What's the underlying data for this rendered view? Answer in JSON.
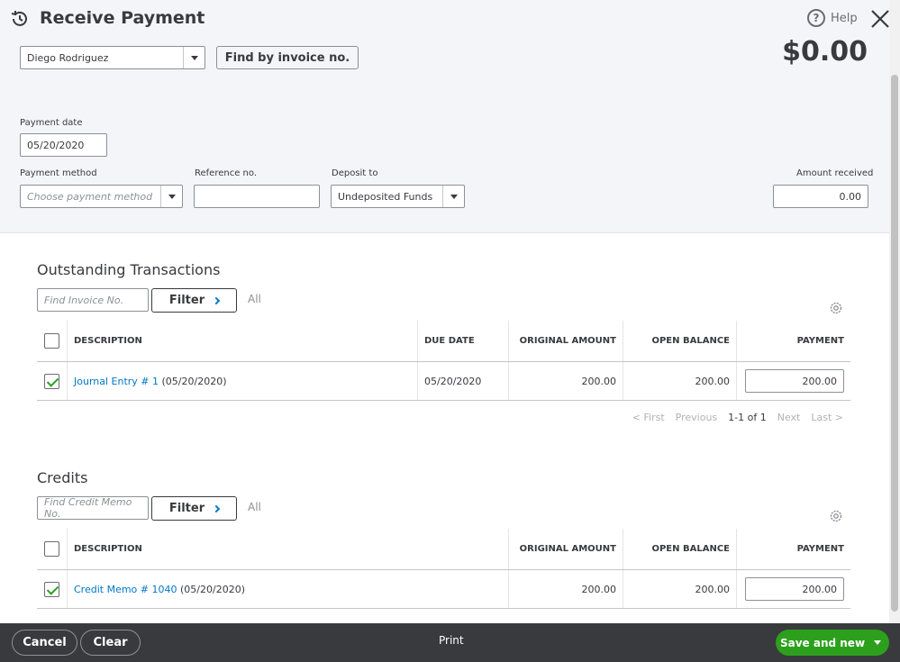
{
  "header": {
    "title": "Receive Payment",
    "help_label": "Help",
    "customer": "Diego Rodriguez",
    "find_invoice_label": "Find by invoice no.",
    "amount_total": "$0.00"
  },
  "form": {
    "payment_date_label": "Payment date",
    "payment_date": "05/20/2020",
    "payment_method_label": "Payment method",
    "payment_method_placeholder": "Choose payment method",
    "reference_label": "Reference no.",
    "reference_value": "",
    "deposit_label": "Deposit to",
    "deposit_value": "Undeposited Funds",
    "amount_received_label": "Amount received",
    "amount_received": "0.00"
  },
  "outstanding": {
    "title": "Outstanding Transactions",
    "search_placeholder": "Find Invoice No.",
    "filter_label": "Filter",
    "all_label": "All",
    "columns": [
      "DESCRIPTION",
      "DUE DATE",
      "ORIGINAL AMOUNT",
      "OPEN BALANCE",
      "PAYMENT"
    ],
    "rows": [
      {
        "link": "Journal Entry # 1",
        "date_suffix": " (05/20/2020)",
        "due_date": "05/20/2020",
        "original": "200.00",
        "open": "200.00",
        "payment": "200.00",
        "checked": true
      }
    ],
    "pager": {
      "first": "< First",
      "previous": "Previous",
      "range": "1-1 of 1",
      "next": "Next",
      "last": "Last >"
    }
  },
  "credits": {
    "title": "Credits",
    "search_placeholder": "Find Credit Memo No.",
    "filter_label": "Filter",
    "all_label": "All",
    "columns": [
      "DESCRIPTION",
      "ORIGINAL AMOUNT",
      "OPEN BALANCE",
      "PAYMENT"
    ],
    "rows": [
      {
        "link": "Credit Memo # 1040",
        "date_suffix": " (05/20/2020)",
        "original": "200.00",
        "open": "200.00",
        "payment": "200.00",
        "checked": true
      }
    ]
  },
  "footer": {
    "cancel_label": "Cancel",
    "clear_label": "Clear",
    "print_label": "Print",
    "save_new_label": "Save and new"
  },
  "icons": {
    "history": "history-icon",
    "help": "help-icon",
    "close": "close-icon",
    "gear": "gear-icon",
    "dropdown": "chevron-down-icon"
  },
  "colors": {
    "accent_green": "#2ca01c",
    "link_blue": "#0077c5",
    "footer_bg": "#393a3d",
    "header_bg": "#f4f5f8"
  }
}
